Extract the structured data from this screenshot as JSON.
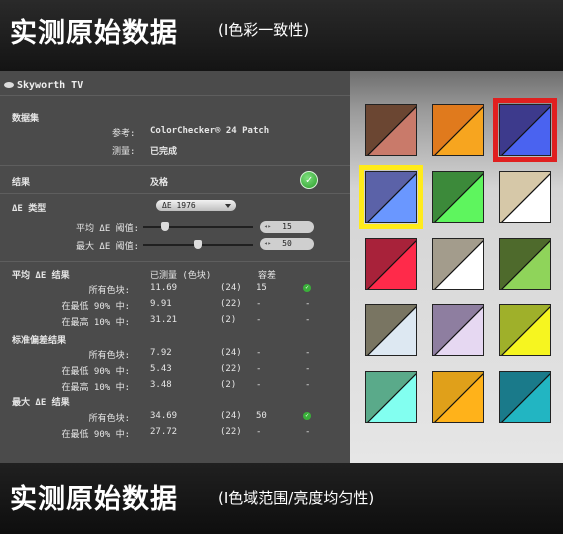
{
  "banners": {
    "top": {
      "main": "实测原始数据",
      "sub": "(I色彩一致性)"
    },
    "bottom": {
      "main": "实测原始数据",
      "sub": "(I色域范围/亮度均匀性)"
    }
  },
  "app": {
    "title": "Skyworth TV"
  },
  "dataset": {
    "heading": "数据集",
    "reference_label": "参考:",
    "reference_value": "ColorChecker® 24 Patch",
    "measurement_label": "测量:",
    "measurement_value": "已完成"
  },
  "result": {
    "label": "结果",
    "value": "及格",
    "icon": "check-circle-icon"
  },
  "delta_e": {
    "type_label": "ΔE 类型",
    "type_value": "ΔE 1976",
    "avg_label": "平均 ΔE 阈值:",
    "avg_threshold": "15",
    "avg_slider_level": 0.18,
    "max_label": "最大 ΔE 阈值:",
    "max_threshold": "50",
    "max_slider_level": 0.5
  },
  "table_headers": {
    "measured": "已测量 (色块)",
    "tolerance": "容差"
  },
  "sections": [
    {
      "title": "平均 ΔE 结果",
      "rows": [
        {
          "label": "所有色块:",
          "value": "11.69",
          "count": "(24)",
          "tol": "15",
          "status": "pass"
        },
        {
          "label": "在最低 90% 中:",
          "value": "9.91",
          "count": "(22)",
          "tol": "-",
          "status": "-"
        },
        {
          "label": "在最高 10% 中:",
          "value": "31.21",
          "count": "(2)",
          "tol": "-",
          "status": "-"
        }
      ]
    },
    {
      "title": "标准偏差结果",
      "rows": [
        {
          "label": "所有色块:",
          "value": "7.92",
          "count": "(24)",
          "tol": "-",
          "status": "-"
        },
        {
          "label": "在最低 90% 中:",
          "value": "5.43",
          "count": "(22)",
          "tol": "-",
          "status": "-"
        },
        {
          "label": "在最高 10% 中:",
          "value": "3.48",
          "count": "(2)",
          "tol": "-",
          "status": "-"
        }
      ]
    },
    {
      "title": "最大 ΔE 结果",
      "rows": [
        {
          "label": "所有色块:",
          "value": "34.69",
          "count": "(24)",
          "tol": "50",
          "status": "pass"
        },
        {
          "label": "在最低 90% 中:",
          "value": "27.72",
          "count": "(22)",
          "tol": "-",
          "status": "-"
        }
      ]
    }
  ],
  "patches": [
    {
      "ref": "#6b4632",
      "meas": "#c97a6a"
    },
    {
      "ref": "#e07a1d",
      "meas": "#f7a51f"
    },
    {
      "ref": "#3d3a8c",
      "meas": "#4a63f0",
      "highlight": "#e02020"
    },
    {
      "ref": "#5b62a8",
      "meas": "#6a97ff",
      "highlight": "#ffeb1a"
    },
    {
      "ref": "#3c8a3a",
      "meas": "#5ef55e"
    },
    {
      "ref": "#d6c8a8",
      "meas": "#ffffff"
    },
    {
      "ref": "#a8223a",
      "meas": "#ff2a4a"
    },
    {
      "ref": "#a39c8c",
      "meas": "#ffffff"
    },
    {
      "ref": "#4e6a2c",
      "meas": "#8fd45a"
    },
    {
      "ref": "#797562",
      "meas": "#dde8f2"
    },
    {
      "ref": "#8e7ea0",
      "meas": "#e6d8f2"
    },
    {
      "ref": "#9fb02a",
      "meas": "#f6f520"
    },
    {
      "ref": "#5aaa8a",
      "meas": "#82fff0"
    },
    {
      "ref": "#e0a01a",
      "meas": "#ffb21a"
    },
    {
      "ref": "#1a7a8a",
      "meas": "#22b5c2"
    }
  ]
}
